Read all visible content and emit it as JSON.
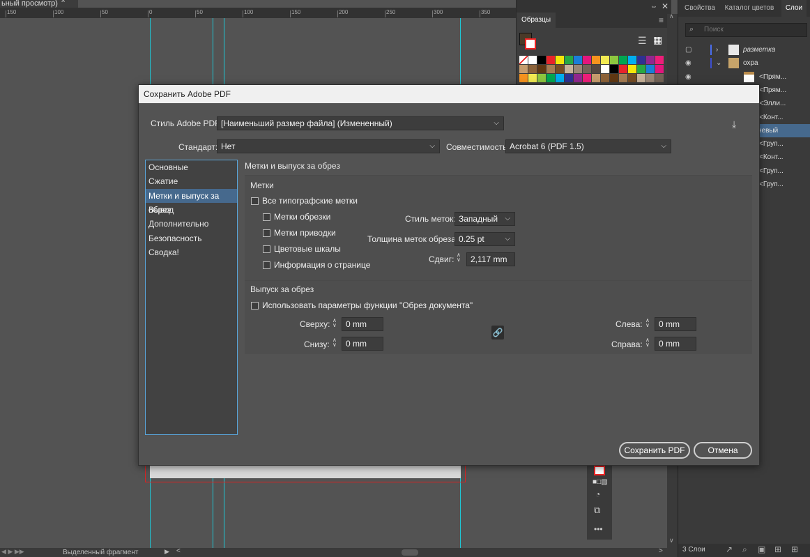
{
  "document": {
    "tab_label": "ьный просмотр)",
    "ruler_ticks": [
      "150",
      "100",
      "50",
      "0",
      "50",
      "100",
      "150",
      "200",
      "250",
      "300",
      "350"
    ]
  },
  "swatches_panel": {
    "title": "Образцы",
    "colors": [
      "#ffffff",
      "#000000",
      "#e8242a",
      "#f4e60a",
      "#27a844",
      "#1a7ed8",
      "#e3157d",
      "#f7931e",
      "#f2ea52",
      "#8dc63f",
      "#00a651",
      "#00aeef",
      "#2e3192",
      "#92278f",
      "#ed1e79",
      "#c69c6d",
      "#8c6239",
      "#603813",
      "#a67c52",
      "#754c24",
      "#c7b299",
      "#998675",
      "#736357",
      "#534741"
    ]
  },
  "right_panel": {
    "tabs": [
      "Свойства",
      "Каталог цветов",
      "Слои"
    ],
    "search_placeholder": "Поиск",
    "layers": [
      {
        "name": "разметка"
      },
      {
        "name": "охра"
      },
      {
        "name": "<Прям..."
      },
      {
        "name": "<Прям..."
      },
      {
        "name": "<Элли..."
      },
      {
        "name": "<Конт..."
      },
      {
        "name": "невый"
      },
      {
        "name": "<Груп..."
      },
      {
        "name": "<Конт..."
      },
      {
        "name": "<Груп..."
      },
      {
        "name": "<Груп..."
      }
    ],
    "footer_label": "3 Слои"
  },
  "status_bar": {
    "selection_label": "Выделенный фрагмент"
  },
  "dialog": {
    "title": "Сохранить Adobe PDF",
    "pdf_style_label": "Стиль Adobe PDF:",
    "pdf_style_value": "[Наименьший размер файла] (Измененный)",
    "standard_label": "Стандарт:",
    "standard_value": "Нет",
    "compat_label": "Совместимость:",
    "compat_value": "Acrobat 6 (PDF 1.5)",
    "nav": [
      "Основные",
      "Сжатие",
      "Метки и выпуск за обрез",
      "Вывод",
      "Дополнительно",
      "Безопасность",
      "Сводка!"
    ],
    "active_nav_index": 2,
    "section_title": "Метки и выпуск за обрез",
    "marks": {
      "heading": "Метки",
      "all_marks": "Все типографские метки",
      "crop_marks": "Метки обрезки",
      "registration_marks": "Метки приводки",
      "color_bars": "Цветовые шкалы",
      "page_info": "Информация о странице",
      "style_label": "Стиль меток:",
      "style_value": "Западный",
      "weight_label": "Толщина меток обреза:",
      "weight_value": "0.25 pt",
      "offset_label": "Сдвиг:",
      "offset_value": "2,117 mm"
    },
    "bleed": {
      "heading": "Выпуск за обрез",
      "use_document": "Использовать параметры функции \"Обрез документа\"",
      "top_label": "Сверху:",
      "top_value": "0 mm",
      "bottom_label": "Снизу:",
      "bottom_value": "0 mm",
      "left_label": "Слева:",
      "left_value": "0 mm",
      "right_label": "Справа:",
      "right_value": "0 mm"
    },
    "save_button": "Сохранить PDF",
    "cancel_button": "Отмена"
  }
}
